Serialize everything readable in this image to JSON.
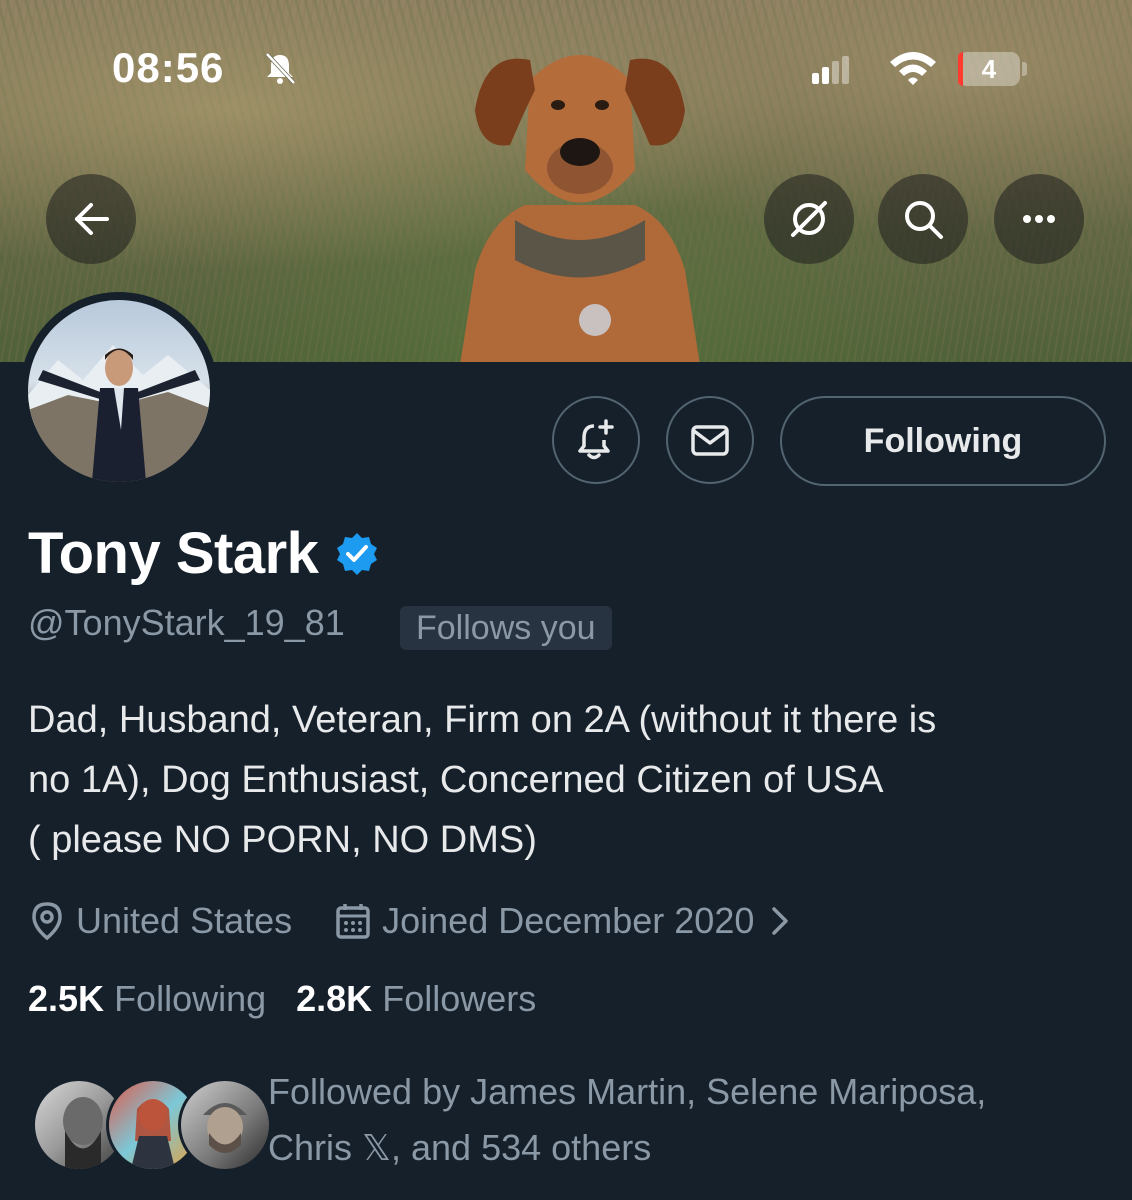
{
  "status_bar": {
    "time": "08:56",
    "battery": "4"
  },
  "nav": {
    "back_icon": "arrow-left-icon",
    "grok_icon": "grok-icon",
    "search_icon": "search-icon",
    "more_icon": "more-icon"
  },
  "actions": {
    "notify_icon": "bell-plus-icon",
    "message_icon": "mail-icon",
    "following_label": "Following"
  },
  "profile": {
    "name": "Tony Stark",
    "handle": "@TonyStark_19_81",
    "follows_you": "Follows you",
    "bio_line1": "Dad, Husband, Veteran, Firm on 2A (without it there is",
    "bio_line2": "no 1A), Dog Enthusiast, Concerned Citizen of USA",
    "bio_line3": "( please NO PORN, NO DMS)",
    "location": "United States",
    "joined": "Joined December 2020"
  },
  "stats": {
    "following_count": "2.5K",
    "following_label": "Following",
    "followers_count": "2.8K",
    "followers_label": "Followers"
  },
  "followed_by": {
    "line1": "Followed by James Martin, Selene Mariposa,",
    "line2": "Chris 𝕏, and 534 others"
  },
  "colors": {
    "background": "#15202b",
    "verified": "#1d9bf0",
    "muted_text": "#8b98a5"
  }
}
